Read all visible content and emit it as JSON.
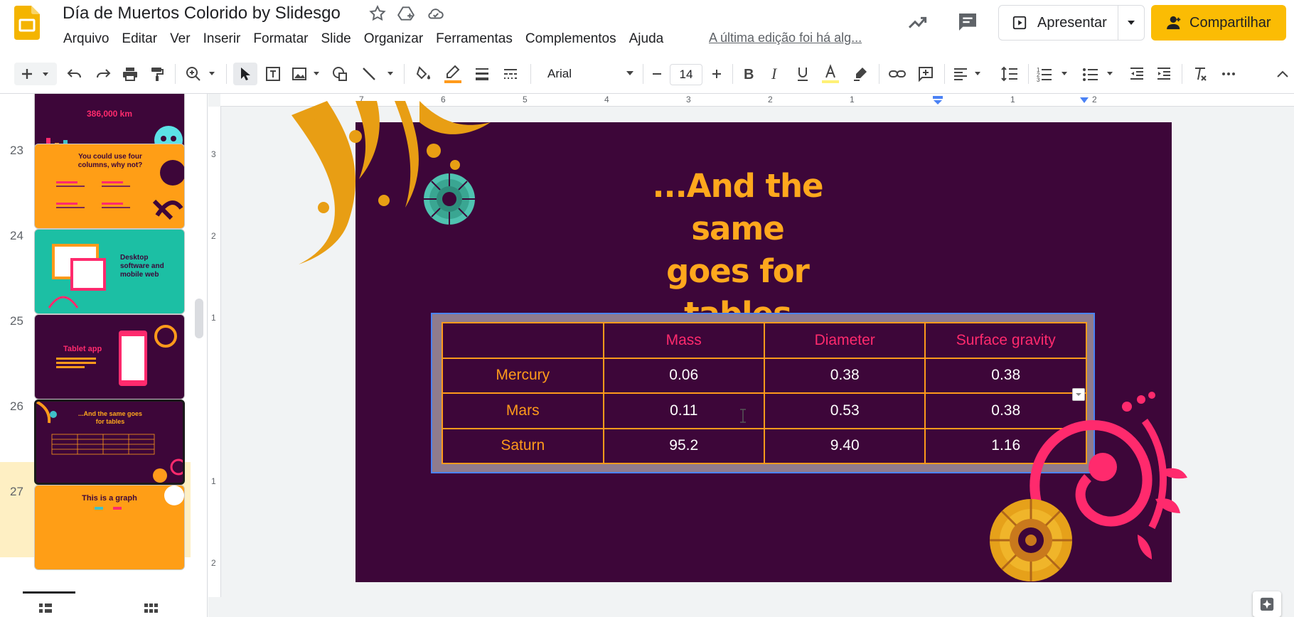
{
  "app": {
    "doc_title": "Día de Muertos Colorido by Slidesgo",
    "last_edit": "A última edição foi há alg...",
    "present_label": "Apresentar",
    "share_label": "Compartilhar"
  },
  "menu": [
    "Arquivo",
    "Editar",
    "Ver",
    "Inserir",
    "Formatar",
    "Slide",
    "Organizar",
    "Ferramentas",
    "Complementos",
    "Ajuda"
  ],
  "toolbar": {
    "font_family": "Arial",
    "font_size": "14"
  },
  "ruler": {
    "h_ticks": [
      "7",
      "6",
      "5",
      "4",
      "3",
      "2",
      "1",
      "1",
      "2"
    ],
    "v_ticks": [
      "3",
      "2",
      "1",
      "1",
      "2"
    ]
  },
  "filmstrip": {
    "slides": [
      {
        "number": "",
        "title": "386,000 km"
      },
      {
        "number": "23",
        "title": "You could use four columns, why not?"
      },
      {
        "number": "24",
        "title": "Desktop software and mobile web"
      },
      {
        "number": "25",
        "title": "Tablet app"
      },
      {
        "number": "26",
        "title": "...And the same goes for tables"
      },
      {
        "number": "27",
        "title": "This is a graph"
      }
    ]
  },
  "slide": {
    "title_line1": "...And the same",
    "title_line2": "goes for tables",
    "table": {
      "headers": [
        "",
        "Mass",
        "Diameter",
        "Surface gravity"
      ],
      "rows": [
        [
          "Mercury",
          "0.06",
          "0.38",
          "0.38"
        ],
        [
          "Mars",
          "0.11",
          "0.53",
          "0.38"
        ],
        [
          "Saturn",
          "95.2",
          "9.40",
          "1.16"
        ]
      ]
    }
  },
  "colors": {
    "slide_bg": "#3d0639",
    "title": "#ffa81d",
    "table_border": "#ff9a1b",
    "header_text": "#ff2a6d",
    "share_button": "#fbbc04"
  }
}
